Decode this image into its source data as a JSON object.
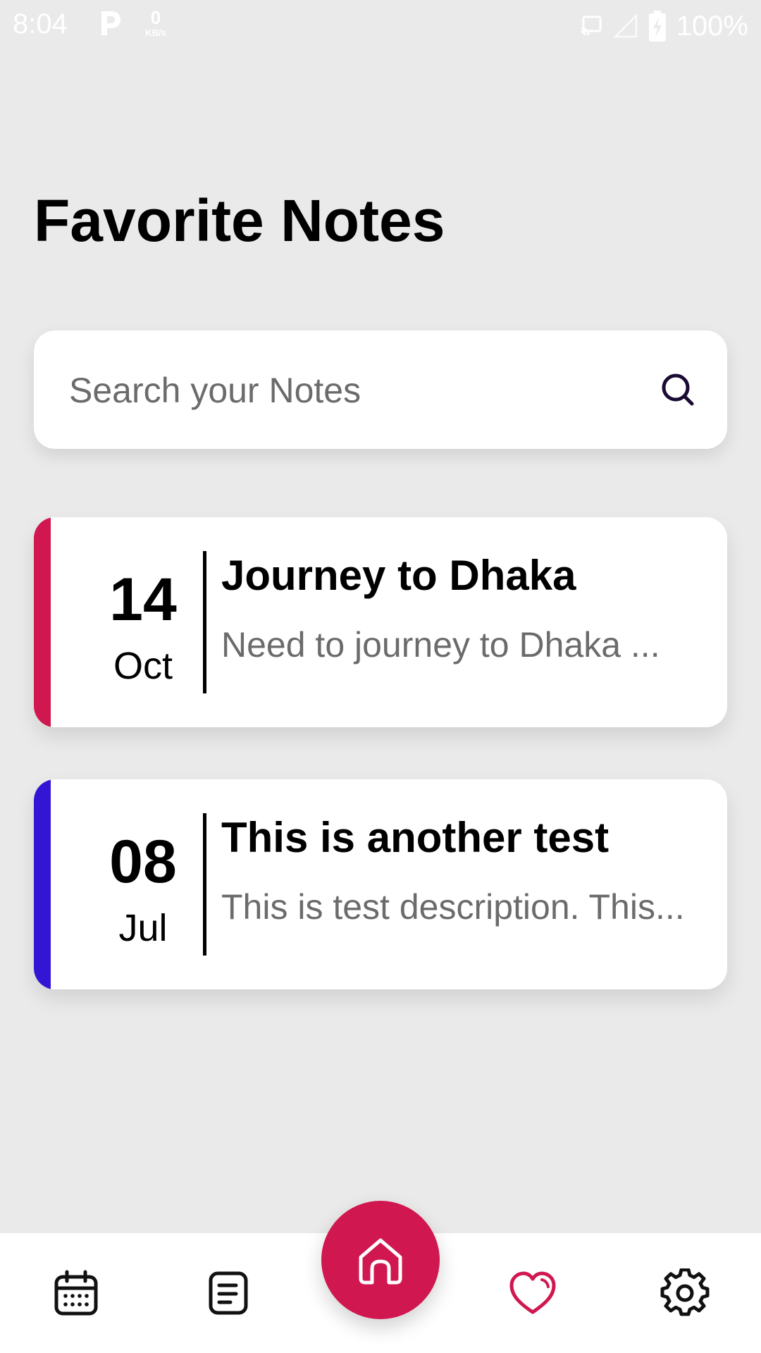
{
  "status_bar": {
    "time": "8:04",
    "net_speed_value": "0",
    "net_speed_unit": "KB/s",
    "battery": "100%"
  },
  "page": {
    "title": "Favorite Notes"
  },
  "search": {
    "placeholder": "Search your Notes",
    "icon": "search-icon"
  },
  "notes": [
    {
      "day": "14",
      "month": "Oct",
      "title": "Journey to Dhaka",
      "description": "Need to journey to Dhaka ...",
      "accent_color": "#D0174F"
    },
    {
      "day": "08",
      "month": "Jul",
      "title": "This is another test",
      "description": "This is test description. This...",
      "accent_color": "#3316D4"
    }
  ],
  "bottom_nav": {
    "items": [
      {
        "name": "calendar",
        "icon": "calendar-icon"
      },
      {
        "name": "notes",
        "icon": "notes-list-icon"
      },
      {
        "name": "home",
        "icon": "home-icon",
        "active_color": "#D0174F"
      },
      {
        "name": "favorites",
        "icon": "heart-icon",
        "active_color": "#D0174F"
      },
      {
        "name": "settings",
        "icon": "gear-icon"
      }
    ]
  },
  "colors": {
    "background": "#EAEAEA",
    "primary": "#D0174F",
    "card": "#FFFFFF"
  }
}
